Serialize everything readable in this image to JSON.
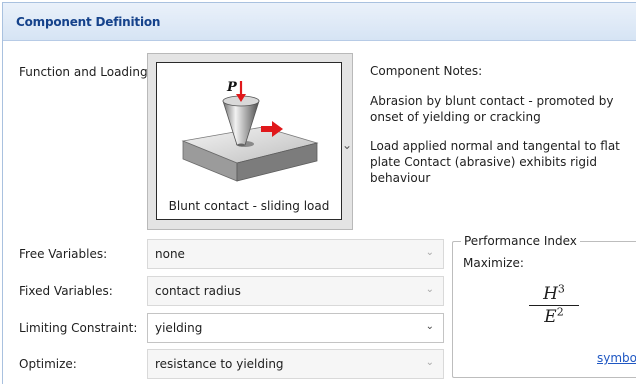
{
  "header": {
    "title": "Component Definition"
  },
  "function_loading": {
    "label": "Function and Loading:",
    "caption": "Blunt contact - sliding load",
    "force_symbol": "P"
  },
  "notes": {
    "title": "Component Notes:",
    "lines": [
      "Abrasion by blunt contact  - promoted by onset of yielding or cracking",
      "Load applied normal and tangental to flat plate Contact (abrasive) exhibits rigid behaviour"
    ]
  },
  "fields": {
    "free": {
      "label": "Free Variables:",
      "value": "none"
    },
    "fixed": {
      "label": "Fixed Variables:",
      "value": "contact radius"
    },
    "limiting": {
      "label": "Limiting Constraint:",
      "value": "yielding"
    },
    "optimize": {
      "label": "Optimize:",
      "value": "resistance to yielding"
    }
  },
  "performance": {
    "legend": "Performance Index",
    "direction": "Maximize:",
    "numerator": "H",
    "numerator_exp": "3",
    "denominator": "E",
    "denominator_exp": "2",
    "link": "symbols"
  },
  "colors": {
    "arrow": "#e0181b",
    "link": "#1f57c3",
    "header_text": "#15428b"
  }
}
